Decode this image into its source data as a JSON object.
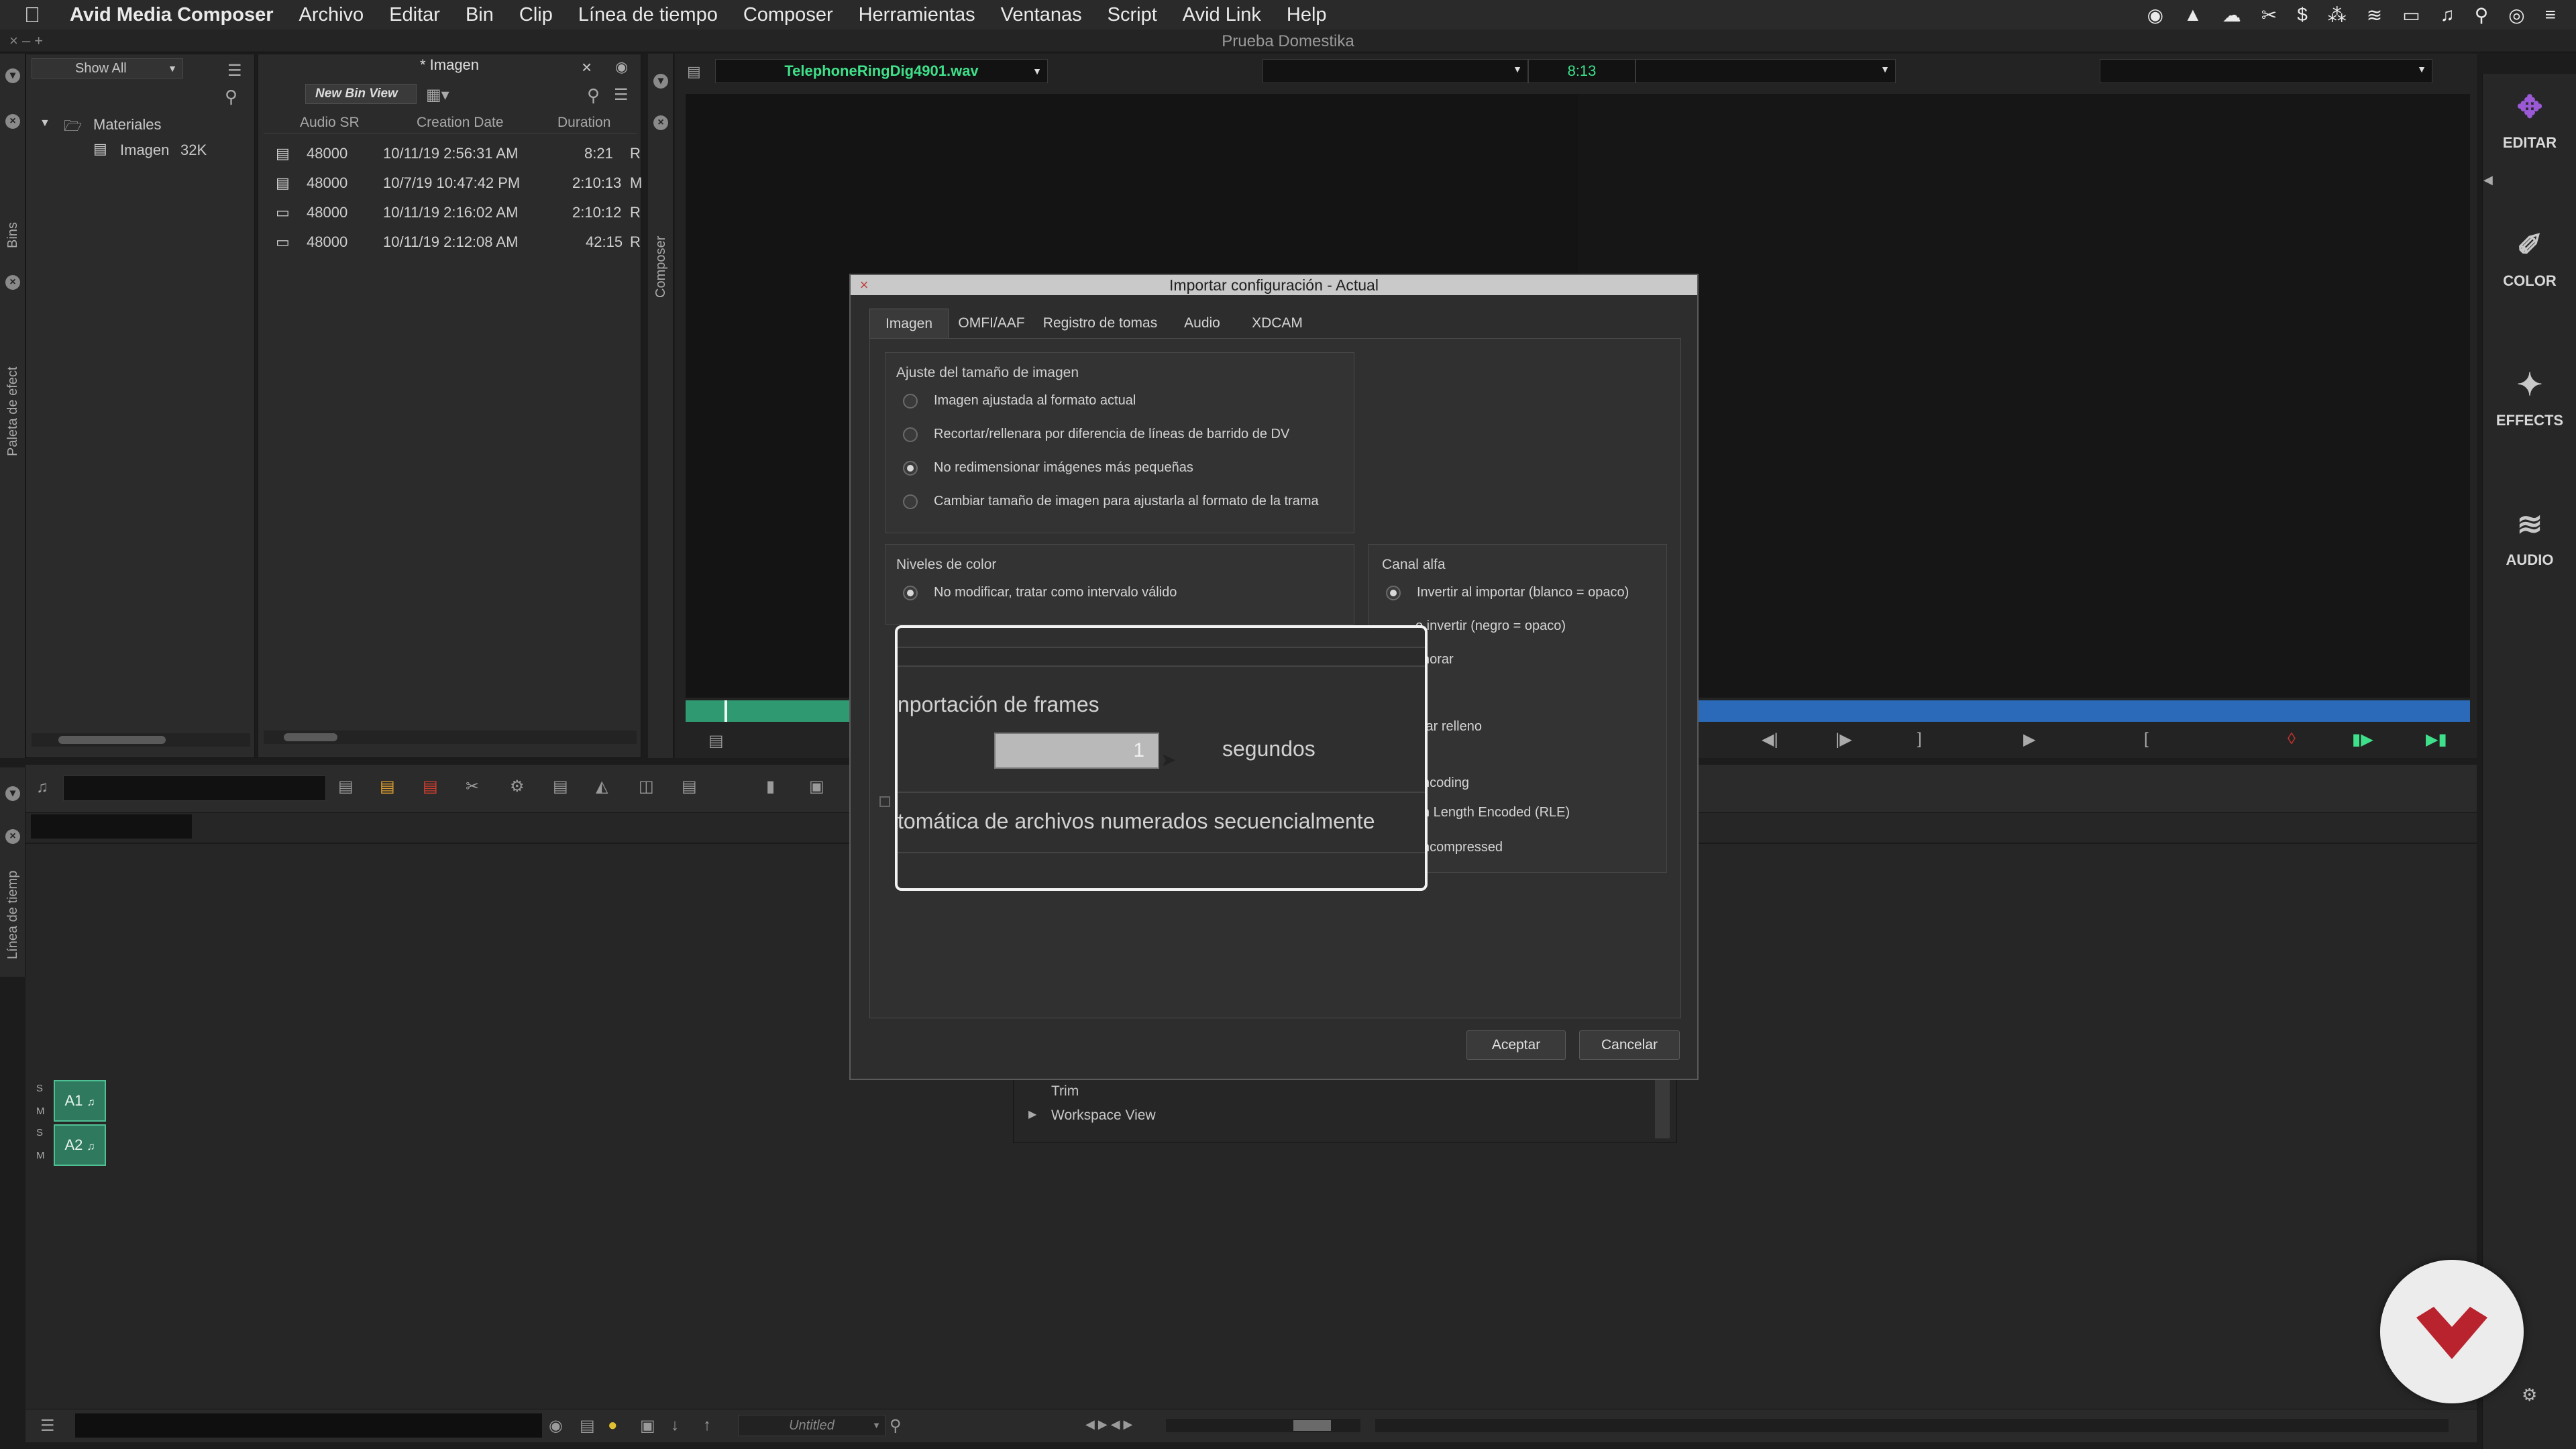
{
  "menubar": {
    "apple": "",
    "items": [
      "Avid Media Composer",
      "Archivo",
      "Editar",
      "Bin",
      "Clip",
      "Línea de tiempo",
      "Composer",
      "Herramientas",
      "Ventanas",
      "Script",
      "Avid Link",
      "Help"
    ]
  },
  "window": {
    "title": "Prueba Domestika",
    "controls": "×  –  +"
  },
  "bins_panel": {
    "tab_label": "Bins",
    "filter": "Show All",
    "tree": [
      {
        "label": "Materiales",
        "expanded": true
      },
      {
        "label": "Imagen",
        "size": "32K"
      }
    ]
  },
  "effects_tab": {
    "label": "Paleta de efect"
  },
  "bin_window": {
    "title": "* Imagen",
    "view": "New Bin View",
    "columns": [
      "Audio SR",
      "Creation Date",
      "Duration"
    ],
    "rows": [
      {
        "audio_sr": "48000",
        "date": "10/11/19 2:56:31 AM",
        "duration": "8:21",
        "extra": "R"
      },
      {
        "audio_sr": "48000",
        "date": "10/7/19 10:47:42 PM",
        "duration": "2:10:13",
        "extra": "M"
      },
      {
        "audio_sr": "48000",
        "date": "10/11/19 2:16:02 AM",
        "duration": "2:10:12",
        "extra": "R"
      },
      {
        "audio_sr": "48000",
        "date": "10/11/19 2:12:08 AM",
        "duration": "42:15",
        "extra": "R"
      }
    ]
  },
  "composer": {
    "tab_label": "Composer",
    "source_clip": "TelephoneRingDig4901.wav",
    "timecode": "8:13"
  },
  "timeline": {
    "tab_label": "Línea de tiemp",
    "tracks": [
      {
        "label": "A1",
        "s": "S",
        "m": "M"
      },
      {
        "label": "A2",
        "s": "S",
        "m": "M"
      }
    ],
    "sequence_name": "Untitled"
  },
  "project_window_items": [
    "Trim",
    "Workspace View"
  ],
  "right_nav": [
    {
      "label": "EDITAR",
      "icon": "edit-icon"
    },
    {
      "label": "COLOR",
      "icon": "brush-icon"
    },
    {
      "label": "EFFECTS",
      "icon": "magic-wand-icon"
    },
    {
      "label": "AUDIO",
      "icon": "waveform-icon"
    }
  ],
  "dialog": {
    "title": "Importar configuración - Actual",
    "tabs": [
      "Imagen",
      "OMFI/AAF",
      "Registro de tomas",
      "Audio",
      "XDCAM"
    ],
    "active_tab": "Imagen",
    "resize_group": {
      "title": "Ajuste del tamaño de imagen",
      "options": [
        {
          "label": "Imagen ajustada al formato actual",
          "selected": false
        },
        {
          "label": "Recortar/rellenara por diferencia de líneas de barrido de DV",
          "selected": false
        },
        {
          "label": "No redimensionar imágenes más pequeñas",
          "selected": true
        },
        {
          "label": "Cambiar tamaño de imagen para ajustarla al formato de la trama",
          "selected": false
        }
      ]
    },
    "color_group": {
      "title": "Niveles de color",
      "options": [
        {
          "label": "No modificar, tratar como intervalo válido",
          "selected": true
        }
      ]
    },
    "alpha_group": {
      "title": "Canal alfa",
      "options": [
        {
          "label": "Invertir al importar (blanco = opaco)",
          "selected": true
        },
        {
          "label": "o invertir (negro = opaco)",
          "selected": false
        },
        {
          "label": "norar",
          "selected": false
        }
      ],
      "extra": [
        "tar relleno",
        "ncoding",
        "n Length Encoded (RLE)",
        "ncompressed"
      ]
    },
    "buttons": {
      "ok": "Aceptar",
      "cancel": "Cancelar"
    }
  },
  "zoom_overlay": {
    "heading": "nportación de frames",
    "value": "1",
    "unit": "segundos",
    "option": "tomática de archivos numerados secuencialmente"
  },
  "colors": {
    "accent_green": "#2f7a5f",
    "clip_name_green": "#3fe08a",
    "edit_purple": "#9b59d6",
    "badge_red": "#b8232e"
  }
}
